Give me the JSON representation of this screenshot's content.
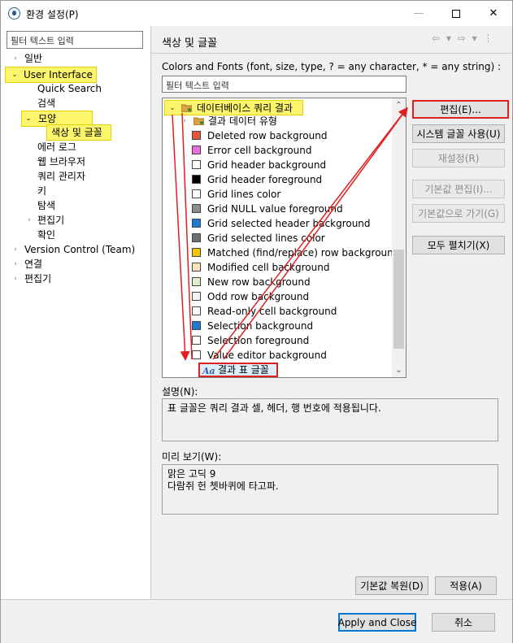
{
  "window": {
    "title": "환경 설정(P)"
  },
  "left": {
    "filter_placeholder": "필터 텍스트 입력",
    "tree": [
      {
        "label": "일반",
        "twisty": "›"
      },
      {
        "label": "User Interface",
        "twisty": "⌄"
      },
      {
        "label": "Quick Search"
      },
      {
        "label": "검색"
      },
      {
        "label": "모양",
        "twisty": "⌄"
      },
      {
        "label": "색상 및 글꼴"
      },
      {
        "label": "에러 로그"
      },
      {
        "label": "웹 브라우저"
      },
      {
        "label": "쿼리 관리자"
      },
      {
        "label": "키"
      },
      {
        "label": "탐색"
      },
      {
        "label": "편집기",
        "twisty": "›"
      },
      {
        "label": "확인"
      },
      {
        "label": "Version Control (Team)",
        "twisty": "›"
      },
      {
        "label": "연결",
        "twisty": "›"
      },
      {
        "label": "편집기",
        "twisty": "›"
      }
    ]
  },
  "right": {
    "title": "색상 및 글꼴",
    "nav_icons": "⇦ ▾ ⇨ ▾ ⋮",
    "description": "Colors and Fonts (font, size, type, ? = any character, * = any string) :",
    "filter_placeholder": "필터 텍스트 입력",
    "category": "데이터베이스 쿼리 결과",
    "subcategory": "결과 데이터 유형",
    "items": [
      {
        "label": "Deleted row background",
        "color": "#e8553d"
      },
      {
        "label": "Error cell background",
        "color": "#ea6ee0"
      },
      {
        "label": "Grid header background",
        "color": "#ffffff"
      },
      {
        "label": "Grid header foreground",
        "color": "#000000"
      },
      {
        "label": "Grid lines color",
        "color": "#ffffff"
      },
      {
        "label": "Grid NULL value foreground",
        "color": "#8c8c8c"
      },
      {
        "label": "Grid selected header background",
        "color": "#1f7ad6"
      },
      {
        "label": "Grid selected lines color",
        "color": "#6e6e6e"
      },
      {
        "label": "Matched (find/replace) row background",
        "color": "#f5c400"
      },
      {
        "label": "Modified cell background",
        "color": "#fde2b8"
      },
      {
        "label": "New row background",
        "color": "#dff0c8"
      },
      {
        "label": "Odd row background",
        "color": "#f2f2f2"
      },
      {
        "label": "Read-only cell background",
        "color": "#ffffff"
      },
      {
        "label": "Selection background",
        "color": "#1f7ad6"
      },
      {
        "label": "Selection foreground",
        "color": "#ffffff"
      },
      {
        "label": "Value editor background",
        "color": "#ffffff"
      }
    ],
    "font_item": "결과 표 글꼴",
    "font_icon_glyph": "Aa",
    "buttons": {
      "edit": "편집(E)...",
      "use_system_font": "시스템 글꼴 사용(U)",
      "reset": "재설정(R)",
      "edit_default": "기본값 편집(I)...",
      "goto_default": "기본값으로 가기(G)",
      "expand_all": "모두 펼치기(X)"
    },
    "description_label": "설명(N):",
    "description_text": "표 글꼴은 쿼리 결과 셀, 헤더, 행 번호에 적용됩니다.",
    "preview_label": "미리 보기(W):",
    "preview_line1": "맑은 고딕 9",
    "preview_line2": "다람쥐 헌 쳇바퀴에 타고파.",
    "restore_defaults": "기본값 복원(D)",
    "apply": "적용(A)"
  },
  "footer": {
    "apply_close": "Apply and Close",
    "cancel": "취소"
  },
  "colors": {
    "highlight": "#fdf56b",
    "annotation": "#e02020",
    "accent": "#0078d7"
  }
}
